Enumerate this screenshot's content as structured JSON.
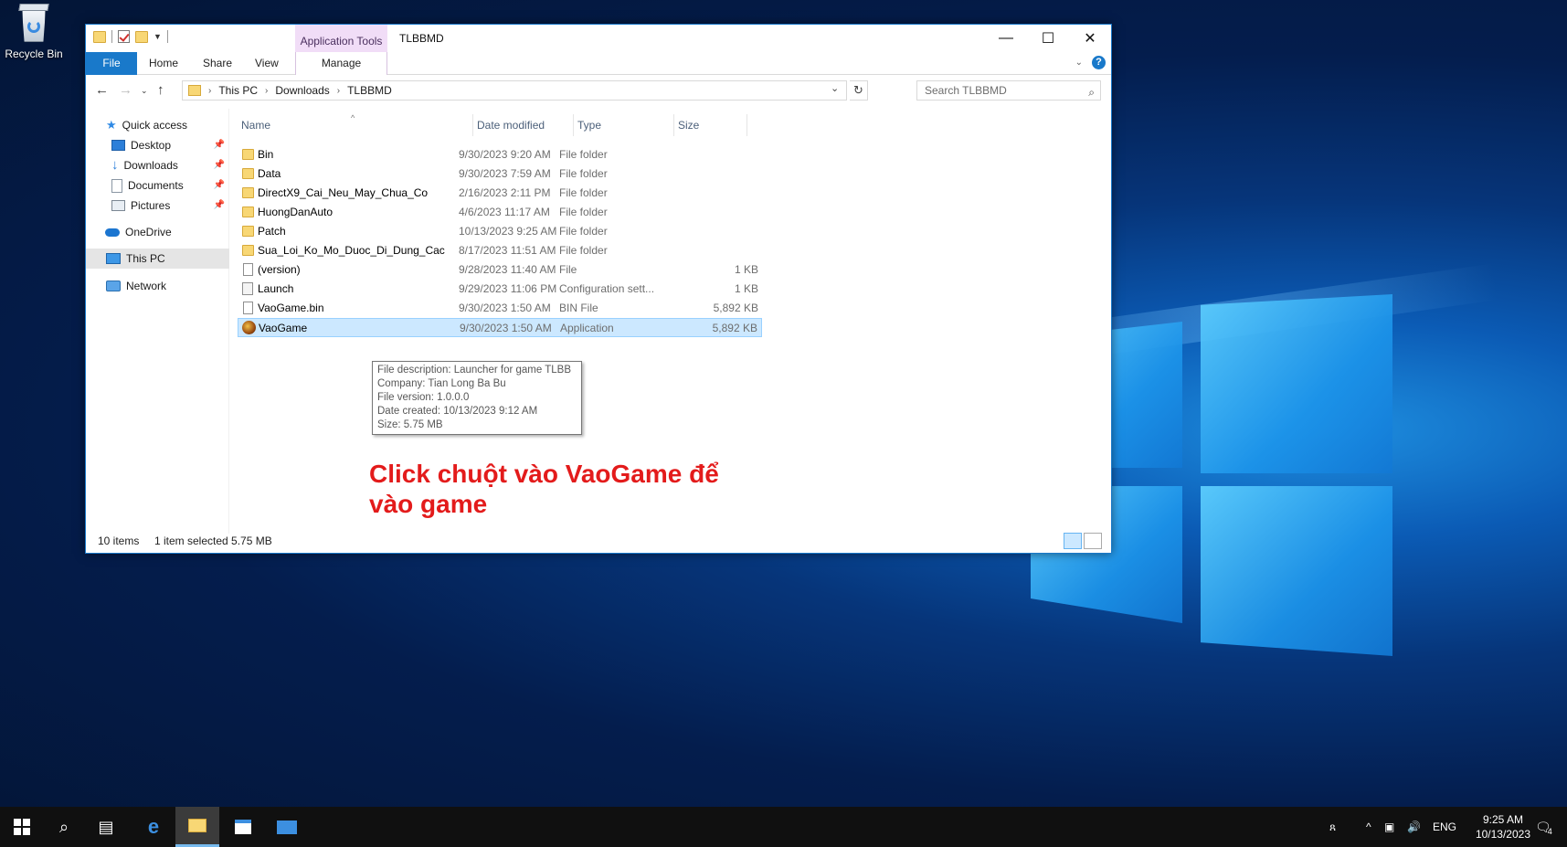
{
  "desktop": {
    "recycle_bin_label": "Recycle Bin"
  },
  "window": {
    "title": "TLBBMD",
    "contextual_tab_group": "Application Tools",
    "ribbon_tabs": [
      "File",
      "Home",
      "Share",
      "View",
      "Manage"
    ],
    "controls": {
      "minimize": "—",
      "maximize": "☐",
      "close": "✕"
    }
  },
  "address": {
    "crumbs": [
      "This PC",
      "Downloads",
      "TLBBMD"
    ],
    "search_placeholder": "Search TLBBMD"
  },
  "nav": {
    "items": [
      {
        "label": "Quick access",
        "icon": "quick-access-star-icon"
      },
      {
        "label": "Desktop",
        "icon": "desktop-icon",
        "pinned": true
      },
      {
        "label": "Downloads",
        "icon": "download-arrow-icon",
        "pinned": true
      },
      {
        "label": "Documents",
        "icon": "document-icon",
        "pinned": true
      },
      {
        "label": "Pictures",
        "icon": "pictures-icon",
        "pinned": true
      },
      {
        "label": "OneDrive",
        "icon": "cloud-icon"
      },
      {
        "label": "This PC",
        "icon": "computer-icon",
        "selected": true
      },
      {
        "label": "Network",
        "icon": "network-icon"
      }
    ]
  },
  "columns": {
    "name": "Name",
    "date": "Date modified",
    "type": "Type",
    "size": "Size"
  },
  "files": [
    {
      "name": "Bin",
      "date": "9/30/2023 9:20 AM",
      "type": "File folder",
      "size": "",
      "icon": "folder"
    },
    {
      "name": "Data",
      "date": "9/30/2023 7:59 AM",
      "type": "File folder",
      "size": "",
      "icon": "folder"
    },
    {
      "name": "DirectX9_Cai_Neu_May_Chua_Co",
      "date": "2/16/2023 2:11 PM",
      "type": "File folder",
      "size": "",
      "icon": "folder"
    },
    {
      "name": "HuongDanAuto",
      "date": "4/6/2023 11:17 AM",
      "type": "File folder",
      "size": "",
      "icon": "folder"
    },
    {
      "name": "Patch",
      "date": "10/13/2023 9:25 AM",
      "type": "File folder",
      "size": "",
      "icon": "folder"
    },
    {
      "name": "Sua_Loi_Ko_Mo_Duoc_Di_Dung_Cac",
      "date": "8/17/2023 11:51 AM",
      "type": "File folder",
      "size": "",
      "icon": "folder"
    },
    {
      "name": "(version)",
      "date": "9/28/2023 11:40 AM",
      "type": "File",
      "size": "1 KB",
      "icon": "file"
    },
    {
      "name": "Launch",
      "date": "9/29/2023 11:06 PM",
      "type": "Configuration sett...",
      "size": "1 KB",
      "icon": "cfg"
    },
    {
      "name": "VaoGame.bin",
      "date": "9/30/2023 1:50 AM",
      "type": "BIN File",
      "size": "5,892 KB",
      "icon": "file"
    },
    {
      "name": "VaoGame",
      "date": "9/30/2023 1:50 AM",
      "type": "Application",
      "size": "5,892 KB",
      "icon": "app",
      "selected": true
    }
  ],
  "tooltip": {
    "lines": [
      "File description: Launcher for game TLBB",
      "Company: Tian Long Ba Bu",
      "File version: 1.0.0.0",
      "Date created: 10/13/2023 9:12 AM",
      "Size: 5.75 MB"
    ]
  },
  "annotation": "Click chuột vào VaoGame để vào game",
  "status": {
    "items": "10 items",
    "selection": "1 item selected  5.75 MB"
  },
  "taskbar": {
    "lang": "ENG",
    "time": "9:25 AM",
    "date": "10/13/2023",
    "notifications": "4"
  },
  "colors": {
    "accent": "#1979ca",
    "selection": "#cce8ff",
    "annotation": "#e31b1b"
  }
}
